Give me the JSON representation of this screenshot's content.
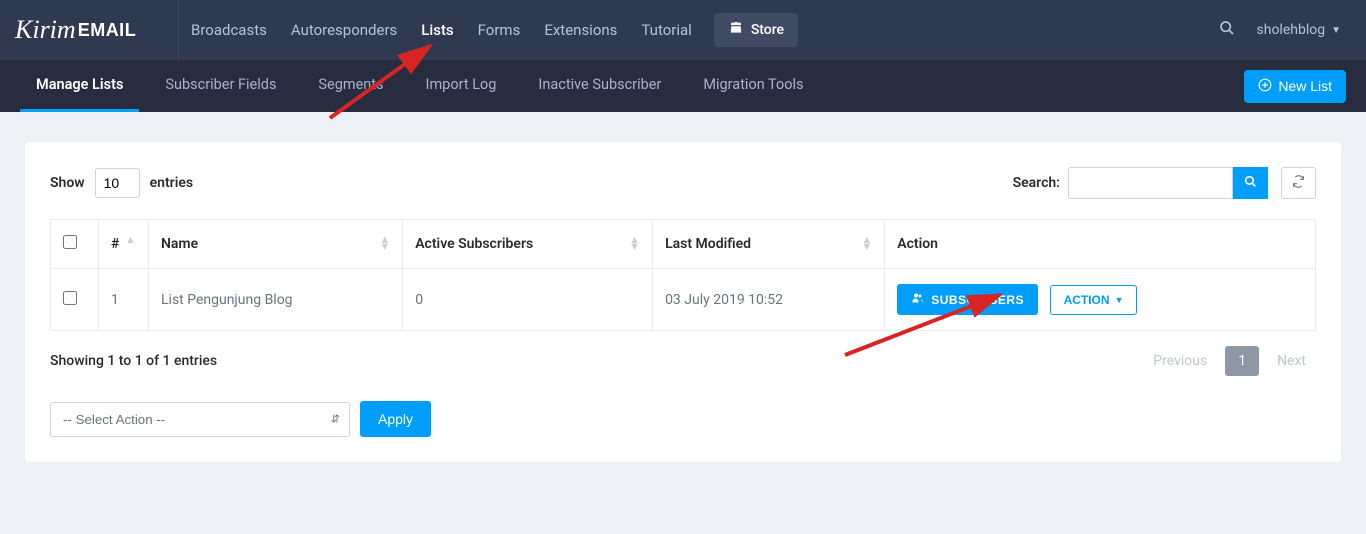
{
  "logo": {
    "part1": "Kirim",
    "part2": "EMAIL"
  },
  "topnav": {
    "broadcasts": "Broadcasts",
    "autoresponders": "Autoresponders",
    "lists": "Lists",
    "forms": "Forms",
    "extensions": "Extensions",
    "tutorial": "Tutorial",
    "store": "Store"
  },
  "user": "sholehblog",
  "subnav": {
    "manage_lists": "Manage Lists",
    "subscriber_fields": "Subscriber Fields",
    "segments": "Segments",
    "import_log": "Import Log",
    "inactive_subscriber": "Inactive Subscriber",
    "migration_tools": "Migration Tools",
    "new_list": "New List"
  },
  "entries": {
    "show_label": "Show",
    "count": "10",
    "entries_label": "entries"
  },
  "search": {
    "label": "Search:",
    "value": ""
  },
  "table": {
    "headers": {
      "num": "#",
      "name": "Name",
      "active_subscribers": "Active Subscribers",
      "last_modified": "Last Modified",
      "action": "Action"
    },
    "rows": [
      {
        "num": "1",
        "name": "List Pengunjung Blog",
        "active_subscribers": "0",
        "last_modified": "03 July 2019 10:52"
      }
    ],
    "buttons": {
      "subscribers": "SUBSCRIBERS",
      "action": "ACTION"
    }
  },
  "footer": {
    "info": "Showing 1 to 1 of 1 entries",
    "previous": "Previous",
    "page": "1",
    "next": "Next"
  },
  "bulk": {
    "placeholder": "-- Select Action --",
    "apply": "Apply"
  }
}
